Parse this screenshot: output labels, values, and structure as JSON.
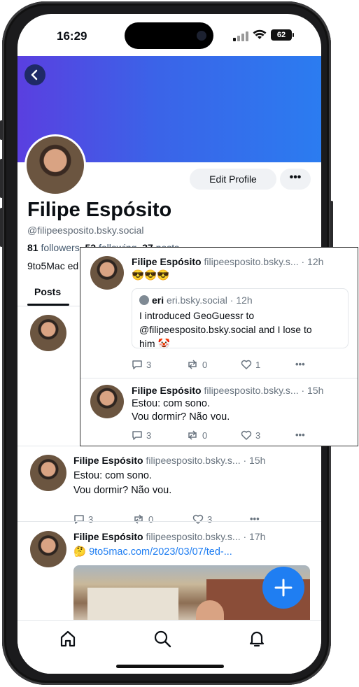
{
  "status": {
    "time": "16:29",
    "battery": "62"
  },
  "profile": {
    "name": "Filipe Espósito",
    "handle": "@filipeesposito.bsky.social",
    "followers_count": "81",
    "followers_label": "followers",
    "following_count": "52",
    "following_label": "following",
    "posts_count": "37",
    "posts_label": "posts",
    "bio": "9to5Mac ed",
    "edit_label": "Edit Profile",
    "more_label": "•••"
  },
  "tabs": {
    "posts": "Posts"
  },
  "posts": [
    {
      "author": "Filipe Espósito",
      "handle": "filipeesposito.bsky.s...",
      "time": "· 15h",
      "text1": "Estou: com sono.",
      "text2": "Vou dormir? Não vou.",
      "replies": "3",
      "reposts": "0",
      "likes": "3"
    },
    {
      "author": "Filipe Espósito",
      "handle": "filipeesposito.bsky.s...",
      "time": "· 17h",
      "emoji": "🤔",
      "link": "9to5mac.com/2023/03/07/ted-..."
    }
  ],
  "popup": {
    "post1": {
      "author": "Filipe Espósito",
      "handle": "filipeesposito.bsky.s...",
      "time": "· 12h",
      "text": "😎😎😎",
      "quote_author": "eri",
      "quote_handle": "eri.bsky.social",
      "quote_time": "· 12h",
      "quote_line1": "I introduced GeoGuessr to",
      "quote_line2": "@filipeesposito.bsky.social  and I lose to",
      "quote_line3": "him 🤡",
      "replies": "3",
      "reposts": "0",
      "likes": "1"
    },
    "post2": {
      "author": "Filipe Espósito",
      "handle": "filipeesposito.bsky.s...",
      "time": "· 15h",
      "text1": "Estou: com sono.",
      "text2": "Vou dormir? Não vou.",
      "replies": "3",
      "reposts": "0",
      "likes": "3"
    }
  },
  "icons": {
    "back": "chevron-left-icon",
    "reply": "speech-bubble-icon",
    "repost": "repost-icon",
    "like": "heart-icon",
    "more": "ellipsis-icon",
    "home": "home-icon",
    "search": "search-icon",
    "notifications": "bell-icon",
    "compose": "plus-icon"
  },
  "colors": {
    "accent": "#1f7ef2",
    "banner_start": "#5a3fe0",
    "banner_end": "#2b7cf0"
  }
}
